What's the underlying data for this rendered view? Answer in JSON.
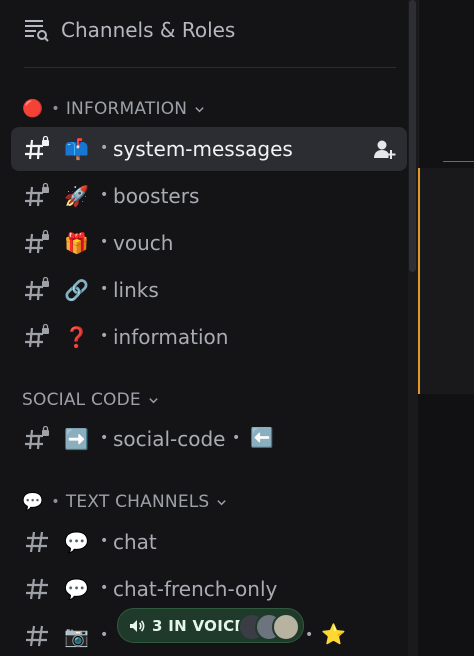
{
  "header": {
    "title": "Channels & Roles",
    "icon": "channels-list-search-icon"
  },
  "categories": [
    {
      "emoji": "🔴",
      "label": "INFORMATION"
    },
    {
      "emoji": "",
      "label": "SOCIAL CODE"
    },
    {
      "emoji": "💬",
      "label": "TEXT CHANNELS"
    }
  ],
  "channels": [
    {
      "emoji": "📫",
      "name": "system-messages",
      "locked": true,
      "active": true
    },
    {
      "emoji": "🚀",
      "name": "boosters",
      "locked": true
    },
    {
      "emoji": "🎁",
      "name": "vouch",
      "locked": true
    },
    {
      "emoji": "🔗",
      "name": "links",
      "locked": true
    },
    {
      "emoji": "❓",
      "name": "information",
      "locked": true
    },
    {
      "emoji": "➡️",
      "name": "social-code",
      "trail_emoji": "⬅️",
      "locked": true
    },
    {
      "emoji": "💬",
      "name": "chat",
      "locked": false
    },
    {
      "emoji": "💬",
      "name": "chat-french-only",
      "locked": false
    },
    {
      "emoji": "📷",
      "name": "",
      "trail_emoji": "⭐",
      "locked": false
    }
  ],
  "voice": {
    "label": "3 IN VOICE",
    "count": 3
  },
  "colors": {
    "background": "#141416",
    "active_row": "#2c2d32",
    "voice_green": "#1f3a2a",
    "accent_orange": "#e09a2a",
    "accent_red": "#c3434a"
  }
}
